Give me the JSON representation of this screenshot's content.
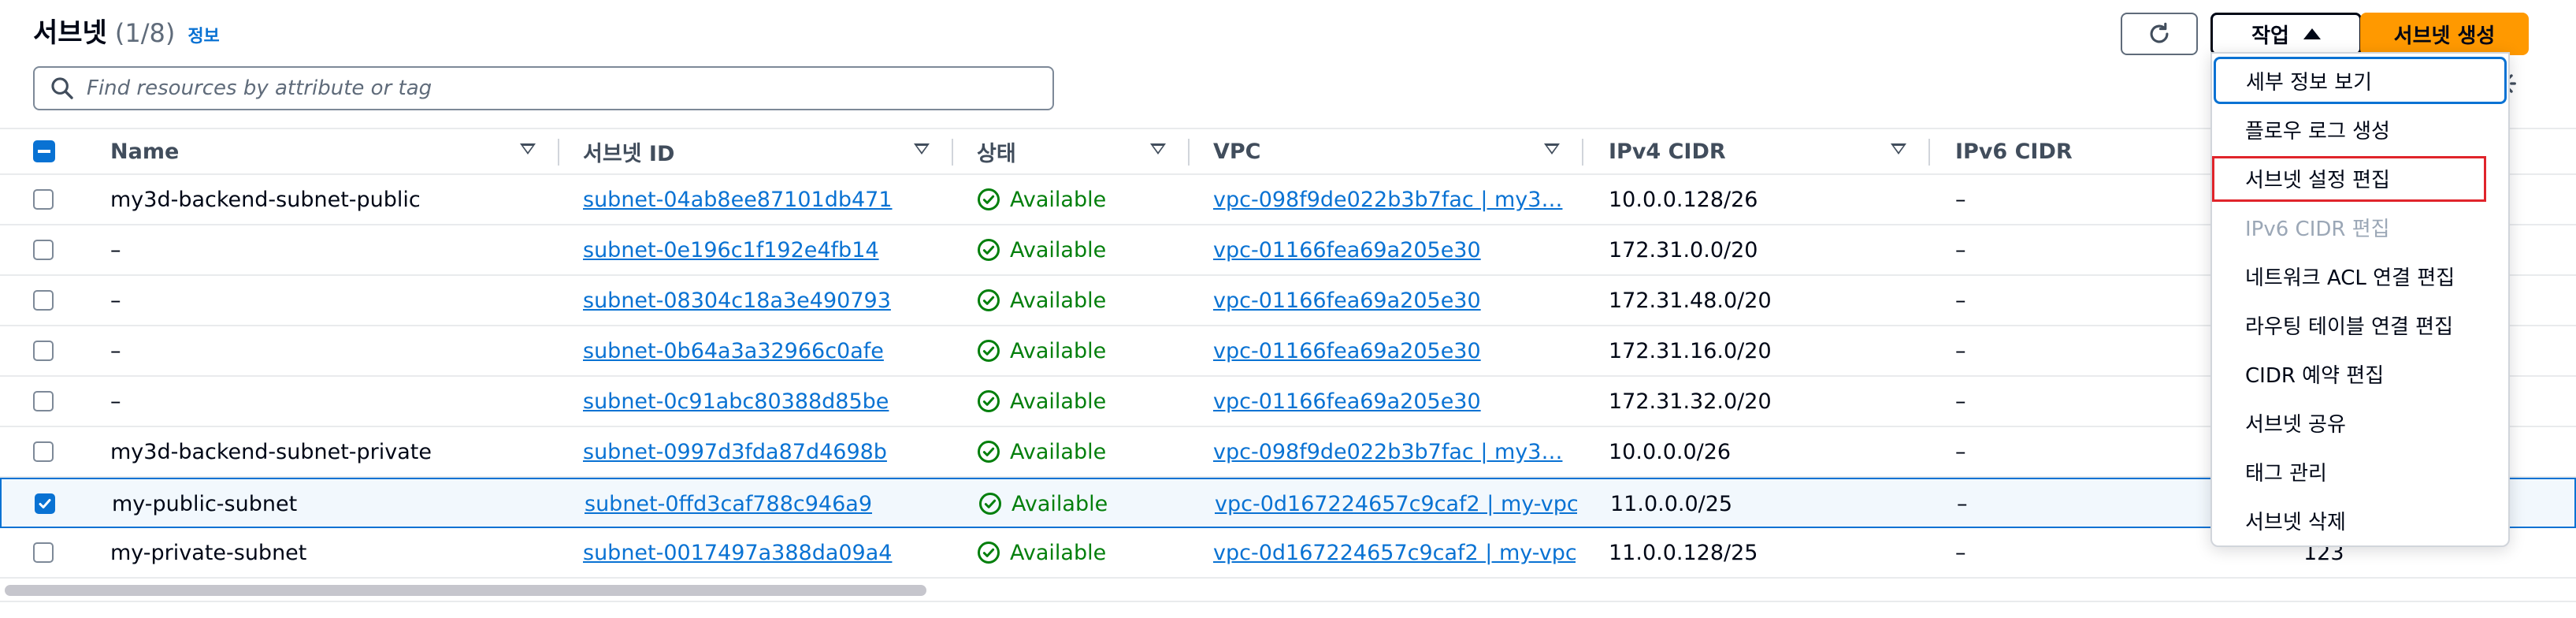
{
  "header": {
    "title": "서브넷",
    "count": "(1/8)",
    "info_label": "정보",
    "actions_label": "작업",
    "create_label": "서브넷 생성"
  },
  "search": {
    "placeholder": "Find resources by attribute or tag"
  },
  "table": {
    "columns": [
      "Name",
      "서브넷 ID",
      "상태",
      "VPC",
      "IPv4 CIDR",
      "IPv6 CIDR"
    ],
    "rows": [
      {
        "name": "my3d-backend-subnet-public",
        "subnet_id": "subnet-04ab8ee87101db471",
        "state": "Available",
        "vpc": "vpc-098f9de022b3b7fac | my3…",
        "ipv4": "10.0.0.128/26",
        "ipv6": "–",
        "selected": false
      },
      {
        "name": "–",
        "subnet_id": "subnet-0e196c1f192e4fb14",
        "state": "Available",
        "vpc": "vpc-01166fea69a205e30",
        "ipv4": "172.31.0.0/20",
        "ipv6": "–",
        "selected": false
      },
      {
        "name": "–",
        "subnet_id": "subnet-08304c18a3e490793",
        "state": "Available",
        "vpc": "vpc-01166fea69a205e30",
        "ipv4": "172.31.48.0/20",
        "ipv6": "–",
        "selected": false
      },
      {
        "name": "–",
        "subnet_id": "subnet-0b64a3a32966c0afe",
        "state": "Available",
        "vpc": "vpc-01166fea69a205e30",
        "ipv4": "172.31.16.0/20",
        "ipv6": "–",
        "selected": false
      },
      {
        "name": "–",
        "subnet_id": "subnet-0c91abc80388d85be",
        "state": "Available",
        "vpc": "vpc-01166fea69a205e30",
        "ipv4": "172.31.32.0/20",
        "ipv6": "–",
        "selected": false
      },
      {
        "name": "my3d-backend-subnet-private",
        "subnet_id": "subnet-0997d3fda87d4698b",
        "state": "Available",
        "vpc": "vpc-098f9de022b3b7fac | my3…",
        "ipv4": "10.0.0.0/26",
        "ipv6": "–",
        "selected": false
      },
      {
        "name": "my-public-subnet",
        "subnet_id": "subnet-0ffd3caf788c946a9",
        "state": "Available",
        "vpc": "vpc-0d167224657c9caf2 | my-vpc",
        "ipv4": "11.0.0.0/25",
        "ipv6": "–",
        "selected": true
      },
      {
        "name": "my-private-subnet",
        "subnet_id": "subnet-0017497a388da09a4",
        "state": "Available",
        "vpc": "vpc-0d167224657c9caf2 | my-vpc",
        "ipv4": "11.0.0.128/25",
        "ipv6": "–",
        "selected": false
      }
    ],
    "overflow_value": "123"
  },
  "actions_menu": {
    "items": [
      {
        "label": "세부 정보 보기",
        "disabled": false
      },
      {
        "label": "플로우 로그 생성",
        "disabled": false
      },
      {
        "label": "서브넷 설정 편집",
        "disabled": false
      },
      {
        "label": "IPv6 CIDR 편집",
        "disabled": true
      },
      {
        "label": "네트워크 ACL 연결 편집",
        "disabled": false
      },
      {
        "label": "라우팅 테이블 연결 편집",
        "disabled": false
      },
      {
        "label": "CIDR 예약 편집",
        "disabled": false
      },
      {
        "label": "서브넷 공유",
        "disabled": false
      },
      {
        "label": "태그 관리",
        "disabled": false
      },
      {
        "label": "서브넷 삭제",
        "disabled": false
      }
    ]
  },
  "colors": {
    "accent": "#0972d3",
    "primary_button": "#ff9900",
    "status_available": "#037f0c",
    "highlight_box": "#e0242b"
  }
}
